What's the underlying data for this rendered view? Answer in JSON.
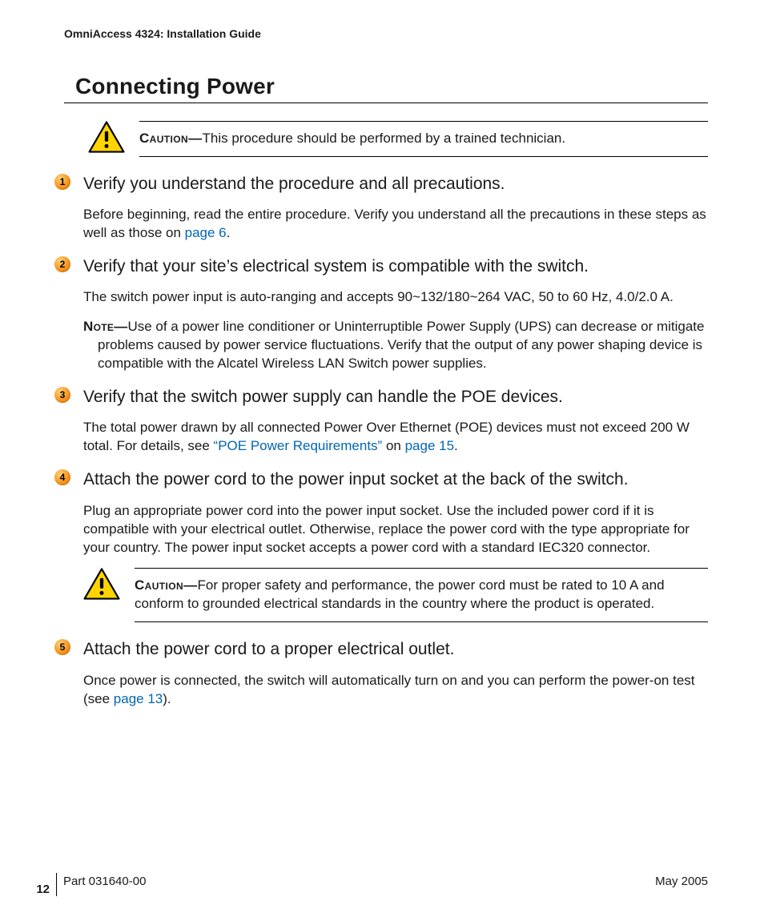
{
  "running_head": "OmniAccess 4324: Installation Guide",
  "section_title": "Connecting Power",
  "caution1": {
    "label": "Caution—",
    "text": "This procedure should be performed by a trained technician."
  },
  "steps": {
    "s1": {
      "num": "1",
      "head": "Verify you understand the procedure and all precautions.",
      "body_pre": "Before beginning, read the entire procedure. Verify you understand all the precautions in these steps as well as those on ",
      "link": "page 6",
      "body_post": "."
    },
    "s2": {
      "num": "2",
      "head": "Verify that your site’s electrical system is compatible with the switch.",
      "body": "The switch power input is auto-ranging and accepts 90~132/180~264 VAC, 50 to 60 Hz, 4.0/2.0 A.",
      "note_label": "Note—",
      "note": "Use of a power line conditioner or Uninterruptible Power Supply (UPS) can decrease or mitigate problems caused by power service fluctuations. Verify that the output of any power shaping device is compatible with the Alcatel Wireless LAN Switch power supplies."
    },
    "s3": {
      "num": "3",
      "head": "Verify that the switch power supply can handle the POE devices.",
      "body_pre": "The total power drawn by all connected Power Over Ethernet (POE) devices must not exceed 200 W total. For details, see ",
      "link1": "“POE Power Requirements”",
      "body_mid": " on ",
      "link2": "page 15",
      "body_post": "."
    },
    "s4": {
      "num": "4",
      "head": "Attach the power cord to the power input socket at the back of the switch.",
      "body": "Plug an appropriate power cord into the power input socket. Use the included power cord if it is compatible with your electrical outlet. Otherwise, replace the power cord with the type appropriate for your country. The power input socket accepts a power cord with a standard IEC320 connector.",
      "caution_label": "Caution—",
      "caution": "For proper safety and performance, the power cord must be rated to 10 A and conform to grounded electrical standards in the country where the product is operated."
    },
    "s5": {
      "num": "5",
      "head": "Attach the power cord to a proper electrical outlet.",
      "body_pre": "Once power is connected, the switch will automatically turn on and you can perform the power-on test (see ",
      "link": "page 13",
      "body_post": ")."
    }
  },
  "footer": {
    "page_num": "12",
    "part": "Part 031640-00",
    "date": "May 2005"
  }
}
